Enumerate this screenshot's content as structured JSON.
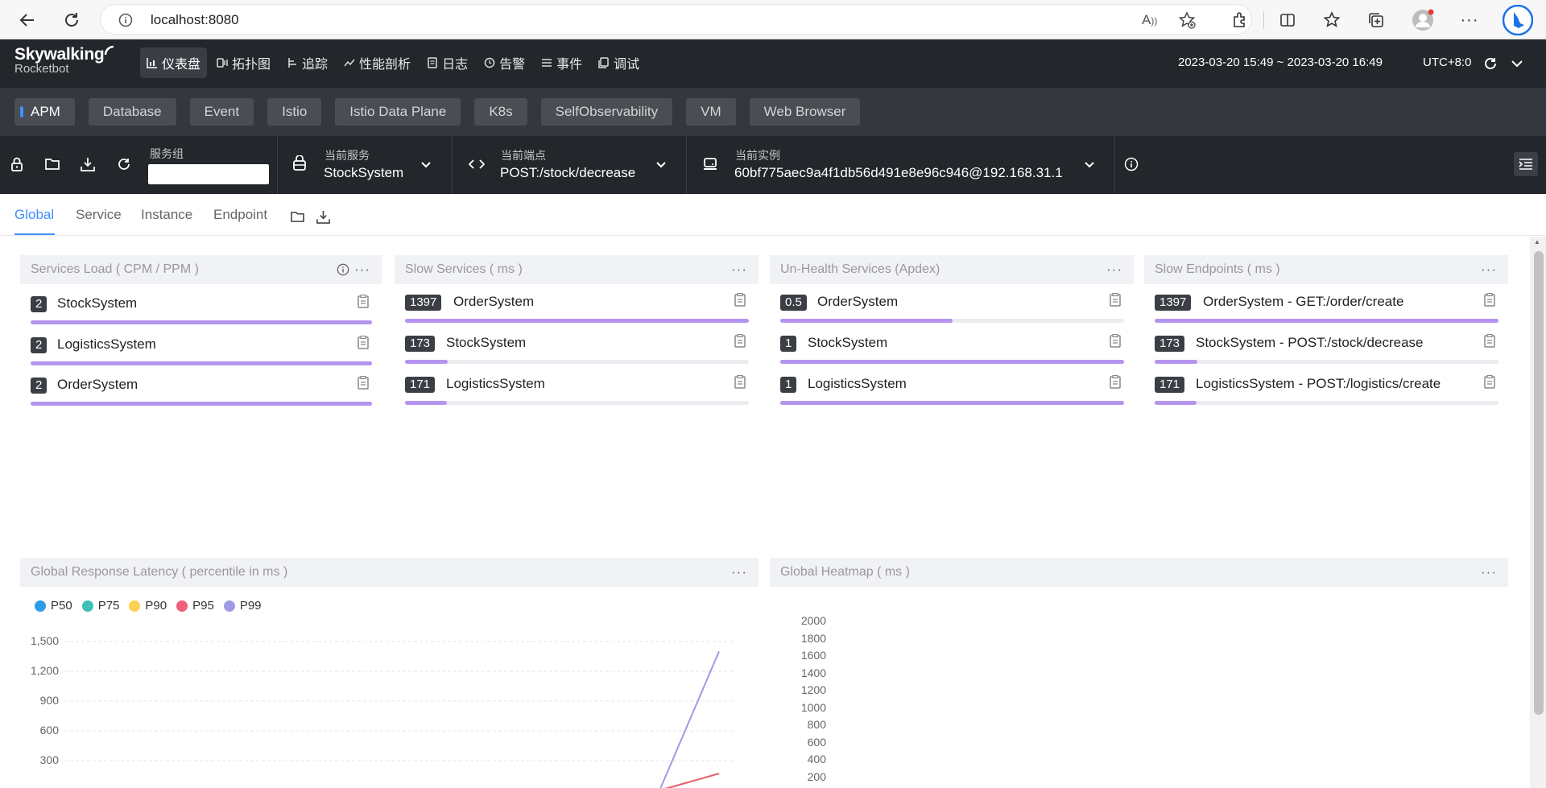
{
  "browser": {
    "url": "localhost:8080"
  },
  "header": {
    "logo_line1": "Skywalking",
    "logo_line2": "Rocketbot",
    "nav": [
      {
        "label": "仪表盘",
        "icon": "dashboard-icon",
        "active": true
      },
      {
        "label": "拓扑图",
        "icon": "topology-icon"
      },
      {
        "label": "追踪",
        "icon": "trace-icon"
      },
      {
        "label": "性能剖析",
        "icon": "profile-icon"
      },
      {
        "label": "日志",
        "icon": "log-icon"
      },
      {
        "label": "告警",
        "icon": "alarm-icon"
      },
      {
        "label": "事件",
        "icon": "event-icon"
      },
      {
        "label": "调试",
        "icon": "debug-icon"
      }
    ],
    "time_range": "2023-03-20 15:49 ~ 2023-03-20 16:49",
    "timezone": "UTC+8:0"
  },
  "layers": [
    "APM",
    "Database",
    "Event",
    "Istio",
    "Istio Data Plane",
    "K8s",
    "SelfObservability",
    "VM",
    "Web Browser"
  ],
  "selectors": {
    "group_label": "服务组",
    "group_value": "",
    "service_label": "当前服务",
    "service_value": "StockSystem",
    "endpoint_label": "当前端点",
    "endpoint_value": "POST:/stock/decrease",
    "instance_label": "当前实例",
    "instance_value": "60bf775aec9a4f1db56d491e8e96c946@192.168.31.1"
  },
  "tabs": [
    "Global",
    "Service",
    "Instance",
    "Endpoint"
  ],
  "widgets": {
    "services_load": {
      "title": "Services Load ( CPM / PPM )",
      "rows": [
        {
          "value": "2",
          "name": "StockSystem",
          "fill": 1.0
        },
        {
          "value": "2",
          "name": "LogisticsSystem",
          "fill": 1.0
        },
        {
          "value": "2",
          "name": "OrderSystem",
          "fill": 1.0
        }
      ]
    },
    "slow_services": {
      "title": "Slow Services ( ms )",
      "rows": [
        {
          "value": "1397",
          "name": "OrderSystem",
          "fill": 1.0
        },
        {
          "value": "173",
          "name": "StockSystem",
          "fill": 0.124
        },
        {
          "value": "171",
          "name": "LogisticsSystem",
          "fill": 0.122
        }
      ]
    },
    "unhealth_services": {
      "title": "Un-Health Services (Apdex)",
      "rows": [
        {
          "value": "0.5",
          "name": "OrderSystem",
          "fill": 0.5
        },
        {
          "value": "1",
          "name": "StockSystem",
          "fill": 1.0
        },
        {
          "value": "1",
          "name": "LogisticsSystem",
          "fill": 1.0
        }
      ]
    },
    "slow_endpoints": {
      "title": "Slow Endpoints ( ms )",
      "rows": [
        {
          "value": "1397",
          "name": "OrderSystem - GET:/order/create",
          "fill": 1.0
        },
        {
          "value": "173",
          "name": "StockSystem - POST:/stock/decrease",
          "fill": 0.124
        },
        {
          "value": "171",
          "name": "LogisticsSystem - POST:/logistics/create",
          "fill": 0.122
        }
      ]
    },
    "latency": {
      "title": "Global Response Latency ( percentile in ms )"
    },
    "heatmap": {
      "title": "Global Heatmap ( ms )",
      "yticks": [
        "2000",
        "1800",
        "1600",
        "1400",
        "1200",
        "1000",
        "800",
        "600",
        "400",
        "200"
      ]
    }
  },
  "chart_data": {
    "type": "line",
    "series": [
      {
        "name": "P50",
        "color": "#2d9be8",
        "values": [
          0,
          0,
          0,
          0,
          0,
          0,
          0,
          0,
          0,
          0,
          0,
          170
        ]
      },
      {
        "name": "P75",
        "color": "#3ec0b8",
        "values": [
          0,
          0,
          0,
          0,
          0,
          0,
          0,
          0,
          0,
          0,
          0,
          170
        ]
      },
      {
        "name": "P90",
        "color": "#fcd052",
        "values": [
          0,
          0,
          0,
          0,
          0,
          0,
          0,
          0,
          0,
          0,
          0,
          170
        ]
      },
      {
        "name": "P95",
        "color": "#f0607a",
        "values": [
          0,
          0,
          0,
          0,
          0,
          0,
          0,
          0,
          0,
          0,
          0,
          170
        ]
      },
      {
        "name": "P99",
        "color": "#9e9ae6",
        "values": [
          0,
          0,
          0,
          0,
          0,
          0,
          0,
          0,
          0,
          0,
          0,
          1400
        ]
      }
    ],
    "yticks": [
      "1,500",
      "1,200",
      "900",
      "600",
      "300"
    ],
    "ylim": [
      0,
      1500
    ],
    "grid": true,
    "legend_position": "top-left"
  }
}
